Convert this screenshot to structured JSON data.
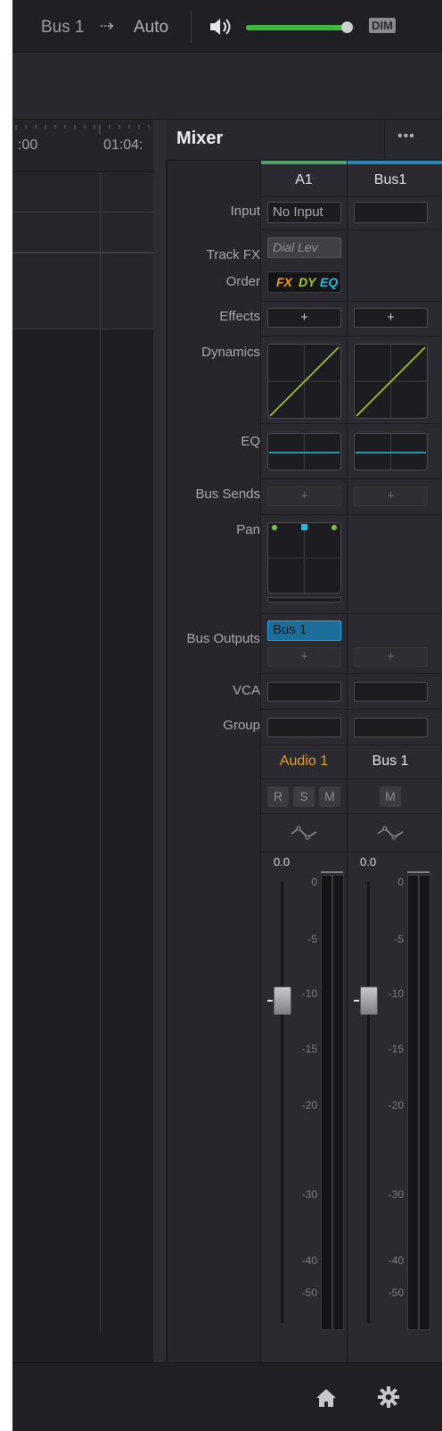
{
  "topbar": {
    "bus_label": "Bus 1",
    "arrow": "⇢",
    "auto_label": "Auto",
    "dim_label": "DIM",
    "volume_fraction": 0.93,
    "accent": "#3eb83e"
  },
  "timeline": {
    "ruler_left": ":00",
    "ruler_right": "01:04:"
  },
  "mixer": {
    "title": "Mixer",
    "more": "•••",
    "row_labels": {
      "input": "Input",
      "track_fx": "Track FX",
      "order": "Order",
      "effects": "Effects",
      "dynamics": "Dynamics",
      "eq": "EQ",
      "bus_sends": "Bus Sends",
      "pan": "Pan",
      "bus_outputs": "Bus Outputs",
      "vca": "VCA",
      "group": "Group"
    },
    "strips": [
      {
        "id": "A1",
        "header_color": "#4aa36a",
        "input_value": "No Input",
        "track_fx": "Dial Lev",
        "order": {
          "fx": "FX",
          "dy": "DY",
          "eq": "EQ"
        },
        "effects_add": "+",
        "bus_sends_add": "+",
        "bus_output": "Bus 1",
        "bus_output_add": "+",
        "name": "Audio 1",
        "name_color": "#e0a030",
        "buttons": [
          "R",
          "S",
          "M"
        ],
        "gain": "0.0"
      },
      {
        "id": "Bus1",
        "header_color": "#2a88b8",
        "input_value": "",
        "effects_add": "+",
        "bus_sends_add": "+",
        "bus_output_add": "+",
        "name": "Bus 1",
        "name_color": "#e0e0e0",
        "buttons": [
          "M"
        ],
        "gain": "0.0"
      }
    ],
    "scale": [
      "0",
      "-5",
      "-10",
      "-15",
      "-20",
      "-30",
      "-40",
      "-50"
    ]
  },
  "colors": {
    "eq_line": "#2fb8d8",
    "dyn_line": "#a8c832",
    "pan_dot": "#7ac143",
    "pan_center": "#2fb8d8"
  }
}
